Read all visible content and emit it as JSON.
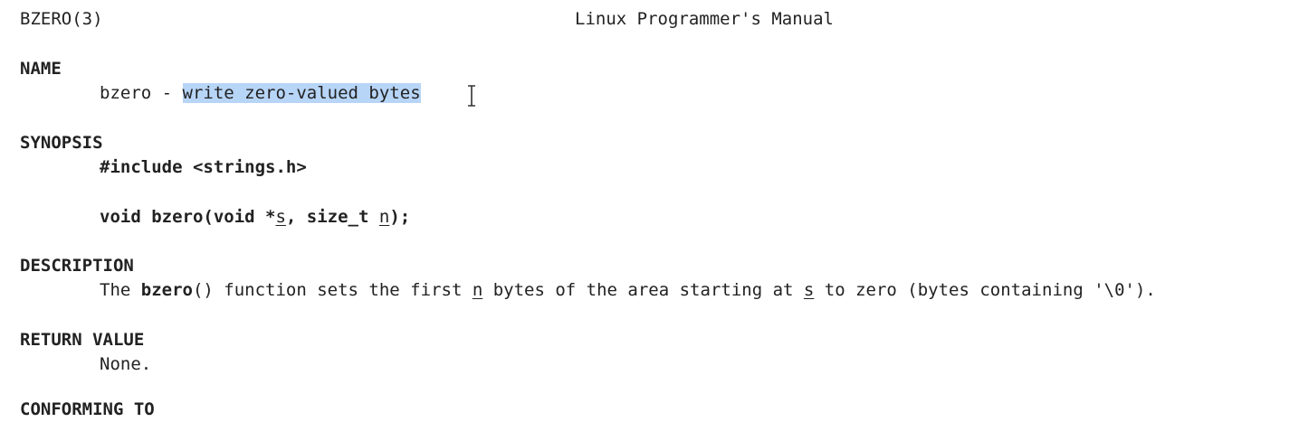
{
  "header": {
    "left": "BZERO(3)",
    "center": "Linux Programmer's Manual"
  },
  "name": {
    "heading": "NAME",
    "fn": "bzero",
    "sep": " - ",
    "desc": "write zero-valued bytes"
  },
  "synopsis": {
    "heading": "SYNOPSIS",
    "include": "#include <strings.h>",
    "proto_pre": "void bzero(void *",
    "proto_arg1": "s",
    "proto_mid": ", size_t ",
    "proto_arg2": "n",
    "proto_end": ");"
  },
  "description": {
    "heading": "DESCRIPTION",
    "t1": "The ",
    "fn": "bzero",
    "t2": "() function sets the first ",
    "arg1": "n",
    "t3": " bytes of the area starting at ",
    "arg2": "s",
    "t4": " to zero (bytes containing '\\0')."
  },
  "return_value": {
    "heading": "RETURN VALUE",
    "text": "None."
  },
  "conforming": {
    "heading": "CONFORMING TO"
  },
  "icons": {
    "cursor": "text-cursor-icon"
  }
}
